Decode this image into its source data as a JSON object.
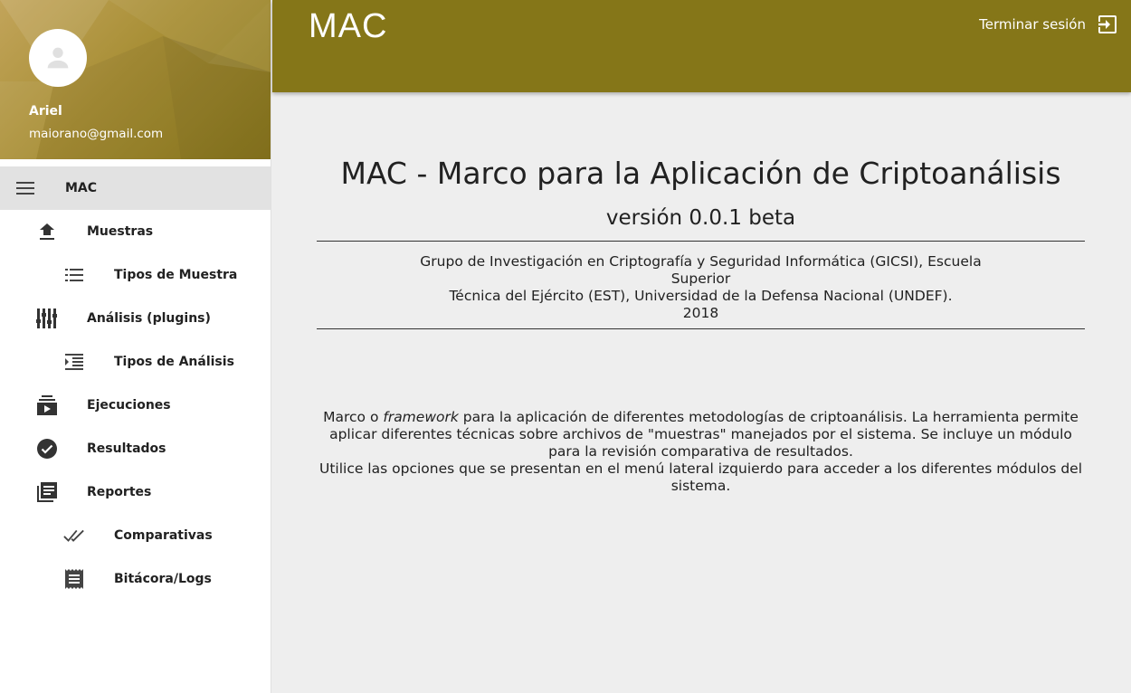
{
  "header": {
    "title": "MAC",
    "logout_label": "Terminar sesión",
    "logout_icon": "exit-to-app-icon",
    "color": "#857618"
  },
  "profile": {
    "name": "Ariel",
    "email": "maiorano@gmail.com",
    "avatar_icon": "person-icon"
  },
  "sidebar": {
    "items": [
      {
        "label": "MAC",
        "icon": "menu-icon",
        "active": true
      },
      {
        "label": "Muestras",
        "icon": "upload-icon"
      },
      {
        "label": "Tipos de Muestra",
        "icon": "list-icon"
      },
      {
        "label": "Análisis (plugins)",
        "icon": "equalizer-icon"
      },
      {
        "label": "Tipos de Análisis",
        "icon": "format-indent-icon"
      },
      {
        "label": "Ejecuciones",
        "icon": "queue-play-icon"
      },
      {
        "label": "Resultados",
        "icon": "check-circle-icon"
      },
      {
        "label": "Reportes",
        "icon": "library-books-icon"
      },
      {
        "label": "Comparativas",
        "icon": "done-all-icon"
      },
      {
        "label": "Bitácora/Logs",
        "icon": "receipt-icon"
      }
    ]
  },
  "main": {
    "title": "MAC - Marco para la Aplicación de Criptoanálisis",
    "version": "versión 0.0.1 beta",
    "org_line1": "Grupo de Investigación en Criptografía y Seguridad Informática (GICSI), Escuela Superior",
    "org_line2": "Técnica del Ejército (EST), Universidad de la Defensa Nacional (UNDEF).",
    "year": "2018",
    "desc_prefix": "Marco o ",
    "desc_em": "framework",
    "desc_rest": " para la aplicación de diferentes metodologías de criptoanálisis. La herramienta permite aplicar diferentes técnicas sobre archivos de \"muestras\" manejados por el sistema. Se incluye un módulo para la revisión comparativa de resultados.",
    "desc_line2": "Utilice las opciones que se presentan en el menú lateral izquierdo para acceder a los diferentes módulos del sistema."
  }
}
